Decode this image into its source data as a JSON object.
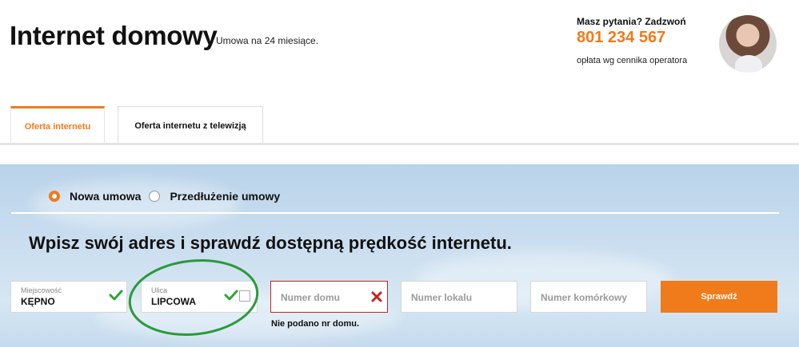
{
  "header": {
    "title": "Internet domowy",
    "subtitle": "Umowa na 24 miesiące.",
    "contact_question": "Masz pytania? Zadzwoń",
    "contact_phone": "801 234 567",
    "contact_note": "opłata wg cennika operatora"
  },
  "tabs": [
    {
      "label": "Oferta internetu",
      "active": true
    },
    {
      "label": "Oferta internetu z telewizją",
      "active": false
    }
  ],
  "contract": {
    "options": [
      {
        "label": "Nowa umowa",
        "selected": true
      },
      {
        "label": "Przedłużenie umowy",
        "selected": false
      }
    ]
  },
  "form": {
    "heading": "Wpisz swój adres i sprawdź dostępną prędkość internetu.",
    "city": {
      "label": "Miejscowość",
      "value": "KĘPNO",
      "valid": true
    },
    "street": {
      "label": "Ulica",
      "value": "LIPCOWA",
      "valid": true
    },
    "house": {
      "placeholder": "Numer domu",
      "valid": false
    },
    "local": {
      "placeholder": "Numer lokalu"
    },
    "mobile": {
      "placeholder": "Numer komórkowy"
    },
    "submit_label": "Sprawdź",
    "error_message": "Nie podano nr domu."
  },
  "colors": {
    "accent": "#f07b1b",
    "error": "#c1251f",
    "valid": "#2fa33a",
    "annotation": "#2a9a3a"
  },
  "icons": [
    "avatar",
    "check-icon",
    "x-icon",
    "checkbox"
  ]
}
